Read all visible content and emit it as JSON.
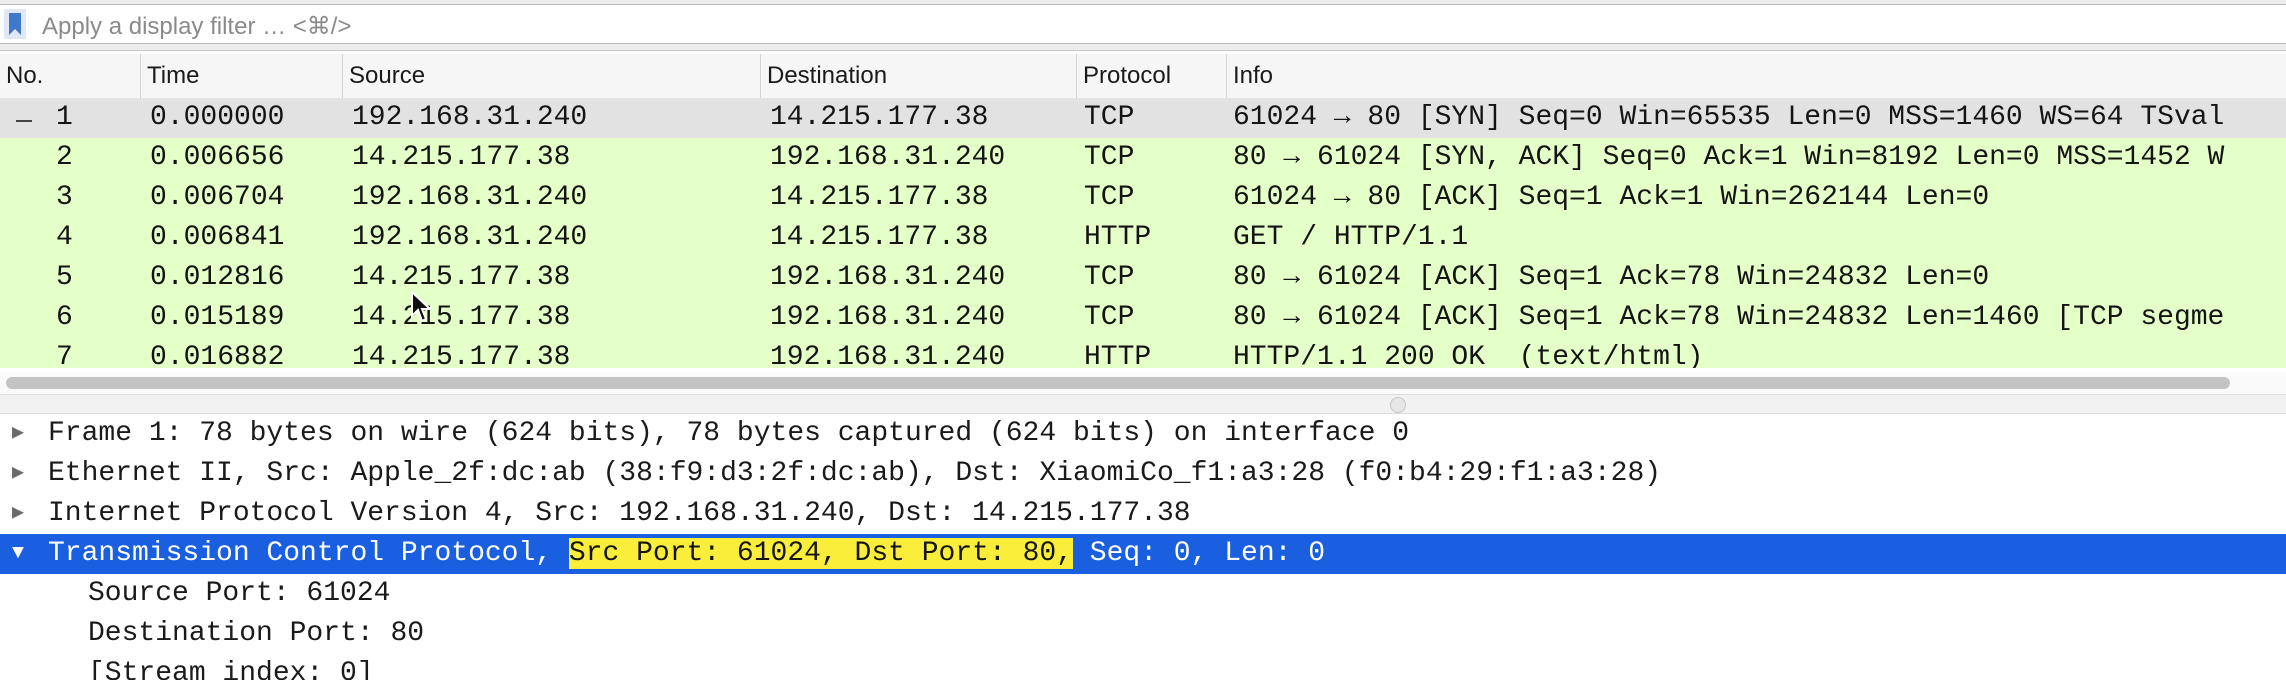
{
  "filter": {
    "placeholder": "Apply a display filter … <⌘/>"
  },
  "columns": {
    "no": "No.",
    "time": "Time",
    "source": "Source",
    "destination": "Destination",
    "protocol": "Protocol",
    "info": "Info"
  },
  "packets": [
    {
      "no": "1",
      "time": "0.000000",
      "source": "192.168.31.240",
      "destination": "14.215.177.38",
      "protocol": "TCP",
      "info": "61024 → 80 [SYN] Seq=0 Win=65535 Len=0 MSS=1460 WS=64 TSval"
    },
    {
      "no": "2",
      "time": "0.006656",
      "source": "14.215.177.38",
      "destination": "192.168.31.240",
      "protocol": "TCP",
      "info": "80 → 61024 [SYN, ACK] Seq=0 Ack=1 Win=8192 Len=0 MSS=1452 W"
    },
    {
      "no": "3",
      "time": "0.006704",
      "source": "192.168.31.240",
      "destination": "14.215.177.38",
      "protocol": "TCP",
      "info": "61024 → 80 [ACK] Seq=1 Ack=1 Win=262144 Len=0"
    },
    {
      "no": "4",
      "time": "0.006841",
      "source": "192.168.31.240",
      "destination": "14.215.177.38",
      "protocol": "HTTP",
      "info": "GET / HTTP/1.1"
    },
    {
      "no": "5",
      "time": "0.012816",
      "source": "14.215.177.38",
      "destination": "192.168.31.240",
      "protocol": "TCP",
      "info": "80 → 61024 [ACK] Seq=1 Ack=78 Win=24832 Len=0"
    },
    {
      "no": "6",
      "time": "0.015189",
      "source": "14.215.177.38",
      "destination": "192.168.31.240",
      "protocol": "TCP",
      "info": "80 → 61024 [ACK] Seq=1 Ack=78 Win=24832 Len=1460 [TCP segme"
    },
    {
      "no": "7",
      "time": "0.016882",
      "source": "14.215.177.38",
      "destination": "192.168.31.240",
      "protocol": "HTTP",
      "info": "HTTP/1.1 200 OK  (text/html)"
    }
  ],
  "details": {
    "frame": "Frame 1: 78 bytes on wire (624 bits), 78 bytes captured (624 bits) on interface 0",
    "ethernet": "Ethernet II, Src: Apple_2f:dc:ab (38:f9:d3:2f:dc:ab), Dst: XiaomiCo_f1:a3:28 (f0:b4:29:f1:a3:28)",
    "ip": "Internet Protocol Version 4, Src: 192.168.31.240, Dst: 14.215.177.38",
    "tcp_prefix": "Transmission Control Protocol, ",
    "tcp_highlight": "Src Port: 61024, Dst Port: 80,",
    "tcp_suffix": " Seq: 0, Len: 0",
    "children": [
      "Source Port: 61024",
      "Destination Port: 80",
      "[Stream index: 0]"
    ],
    "collapsed_symbol": "▶",
    "expanded_symbol": "▼"
  },
  "colors": {
    "tcp_row": "#e4ffc7",
    "selected_row": "#e2e2e2",
    "selection_blue": "#1a5fe0",
    "field_highlight": "#fbee3a"
  }
}
